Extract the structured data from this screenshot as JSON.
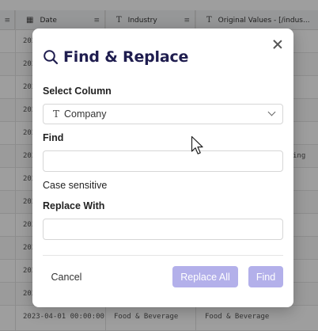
{
  "grid": {
    "columns": [
      {
        "icon": "date-icon",
        "label": "Date"
      },
      {
        "icon": "text-type-icon",
        "label": "Industry"
      },
      {
        "icon": "text-type-icon",
        "label": "Original Values - [/indus..."
      }
    ],
    "visible_row_fragments": {
      "left_stub": "202",
      "right_stub": "ing",
      "last_row": {
        "date": "2023-04-01 00:00:00",
        "industry": "Food & Beverage",
        "original": "Food & Beverage"
      }
    }
  },
  "modal": {
    "title": "Find & Replace",
    "title_icon": "search-icon",
    "close_icon": "close-icon",
    "select_column_label": "Select Column",
    "select_column_value": "Company",
    "select_column_type_icon": "text-type-icon",
    "find_label": "Find",
    "find_value": "",
    "case_sensitive_label": "Case sensitive",
    "replace_label": "Replace With",
    "replace_value": "",
    "cancel_label": "Cancel",
    "replace_all_label": "Replace All",
    "find_button_label": "Find"
  },
  "colors": {
    "title": "#1f1d4f",
    "primary_disabled": "#b3b0ea",
    "overlay": "rgba(0,0,0,0.38)"
  }
}
